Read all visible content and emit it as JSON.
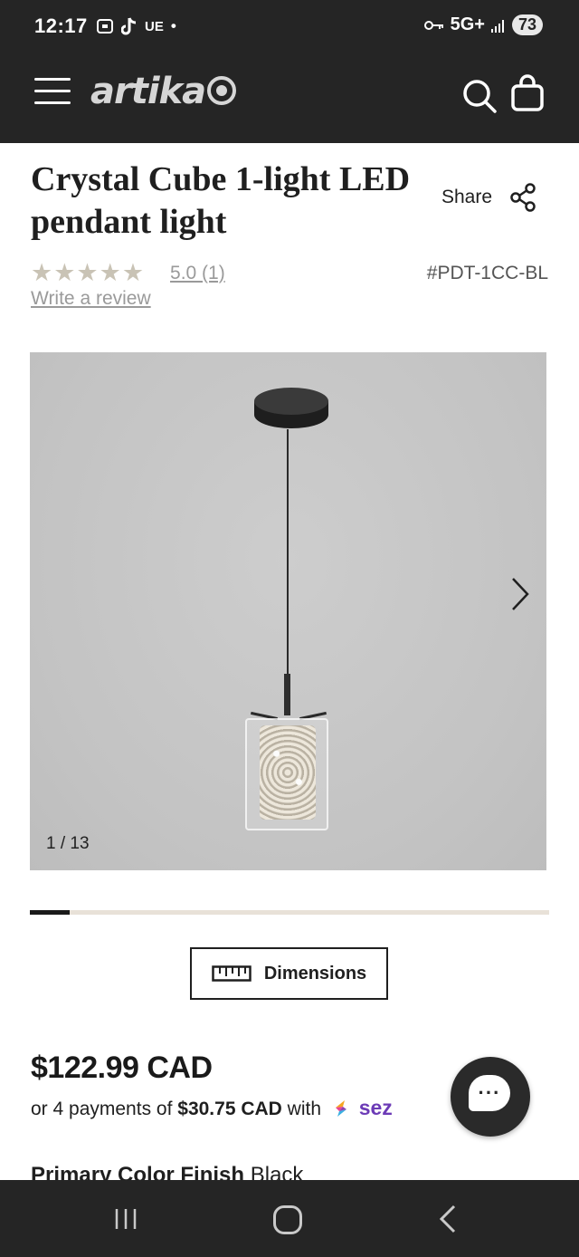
{
  "status_bar": {
    "time": "12:17",
    "left_label": "UE",
    "network": "5G+",
    "battery": "73"
  },
  "header": {
    "logo_text": "artika",
    "icons": [
      "menu-icon",
      "search-icon",
      "bag-icon"
    ]
  },
  "product": {
    "title": "Crystal Cube 1-light LED pendant light",
    "share_label": "Share",
    "stars": "★★★★★",
    "rating_text": "5.0 (1)",
    "rating_value": 5.0,
    "sku": "#PDT-1CC-BL",
    "write_review": "Write a review"
  },
  "gallery": {
    "counter": "1 / 13",
    "progress_fraction": 0.0769
  },
  "dimensions_button": {
    "label": "Dimensions"
  },
  "pricing": {
    "price": "$122.99 CAD",
    "installment_prefix": "or 4 payments of",
    "installment_amount": "$30.75 CAD",
    "installment_with": "with",
    "provider_visible": "sez"
  },
  "finish": {
    "label": "Primary Color Finish",
    "value": "Black"
  },
  "colors": {
    "dark_bar": "#252525",
    "star": "#c9c3b5",
    "progress_track": "#e8e1d8",
    "sezzle": "#6c3bb6"
  }
}
